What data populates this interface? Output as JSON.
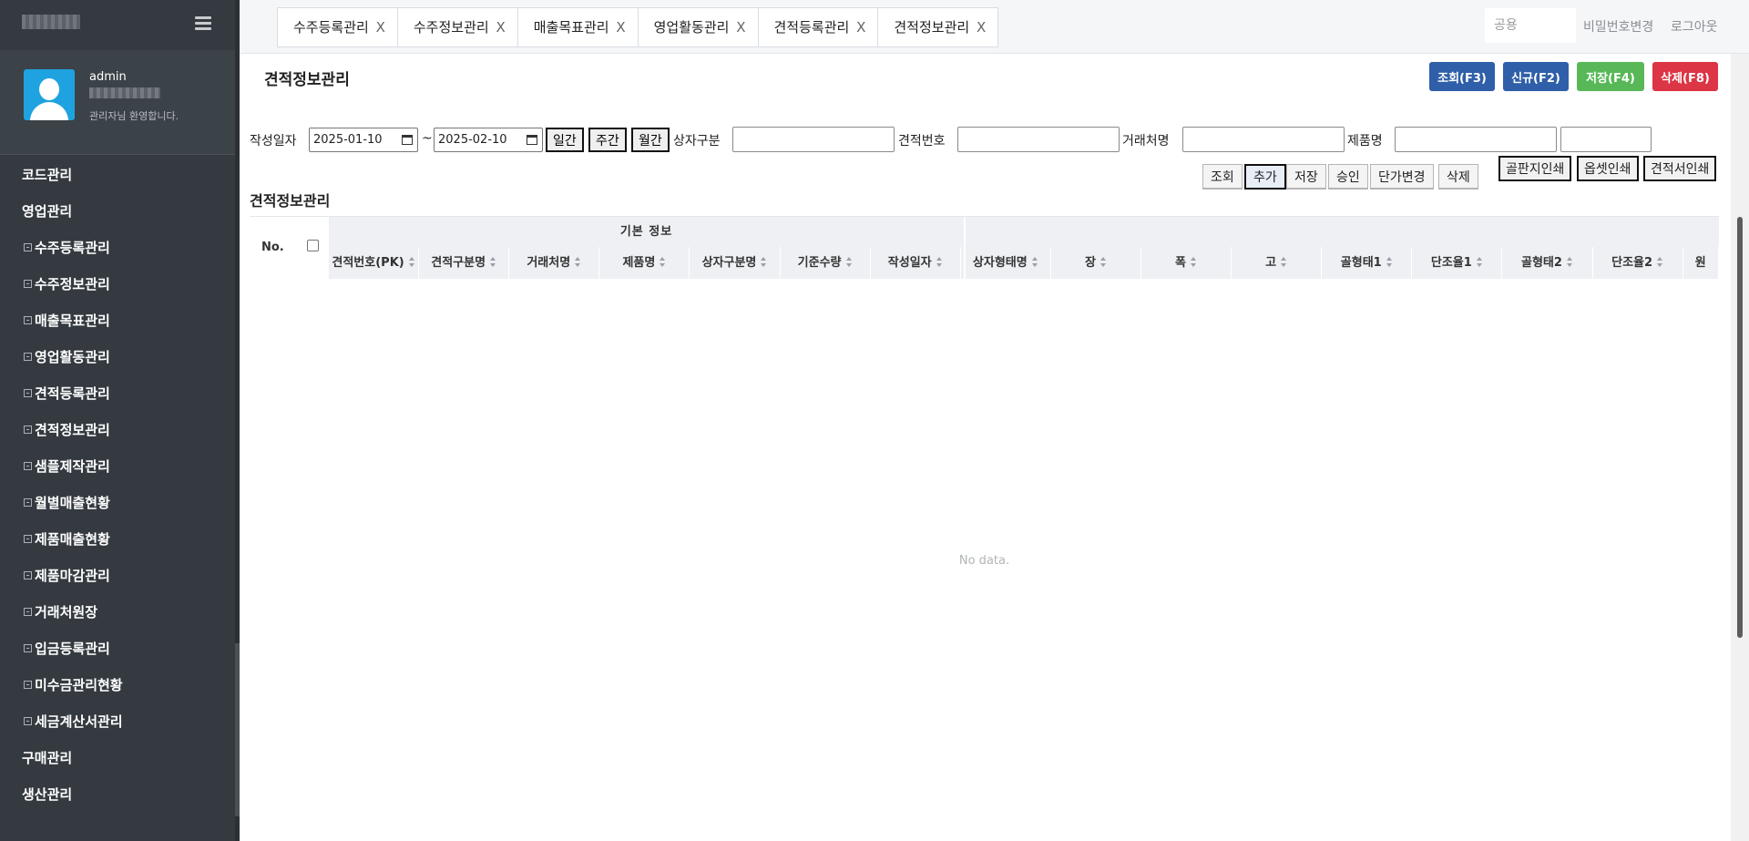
{
  "sidebar": {
    "user": {
      "name": "admin",
      "greeting": "관리자님 환영합니다."
    },
    "menu": [
      {
        "label": "코드관리",
        "sub": false
      },
      {
        "label": "영업관리",
        "sub": false
      },
      {
        "label": "수주등록관리",
        "sub": true
      },
      {
        "label": "수주정보관리",
        "sub": true
      },
      {
        "label": "매출목표관리",
        "sub": true
      },
      {
        "label": "영업활동관리",
        "sub": true
      },
      {
        "label": "견적등록관리",
        "sub": true
      },
      {
        "label": "견적정보관리",
        "sub": true
      },
      {
        "label": "샘플제작관리",
        "sub": true
      },
      {
        "label": "월별매출현황",
        "sub": true
      },
      {
        "label": "제품매출현황",
        "sub": true
      },
      {
        "label": "제품마감관리",
        "sub": true
      },
      {
        "label": "거래처원장",
        "sub": true
      },
      {
        "label": "입금등록관리",
        "sub": true
      },
      {
        "label": "미수금관리현황",
        "sub": true
      },
      {
        "label": "세금계산서관리",
        "sub": true
      },
      {
        "label": "구매관리",
        "sub": false
      },
      {
        "label": "생산관리",
        "sub": false
      }
    ]
  },
  "tabs": [
    "수주등록관리",
    "수주정보관리",
    "매출목표관리",
    "영업활동관리",
    "견적등록관리",
    "견적정보관리"
  ],
  "tab_close": "X",
  "header": {
    "search_placeholder": "공용",
    "change_password": "비밀번호변경",
    "logout": "로그아웃"
  },
  "page": {
    "title": "견적정보관리",
    "actions": {
      "search": "조회(F3)",
      "new": "신규(F2)",
      "save": "저장(F4)",
      "delete": "삭제(F8)"
    }
  },
  "filters": {
    "date_label": "작성일자",
    "date_from": "2025-01-10",
    "date_sep": "~",
    "date_to": "2025-02-10",
    "period_daily": "일간",
    "period_weekly": "주간",
    "period_monthly": "월간",
    "box_type_label": "상자구분",
    "estimate_no_label": "견적번호",
    "client_label": "거래처명",
    "product_label": "제품명"
  },
  "grid_buttons": {
    "search": "조회",
    "add": "추가",
    "save": "저장",
    "approve": "승인",
    "price_change": "단가변경",
    "delete": "삭제"
  },
  "print_buttons": {
    "corrugated": "골판지인쇄",
    "offset": "옵셋인쇄",
    "estimate": "견적서인쇄"
  },
  "grid": {
    "section_title": "견적정보관리",
    "no_label": "No.",
    "group_label": "기본 정보",
    "columns": [
      "견적번호(PK)",
      "견적구분명",
      "거래처명",
      "제품명",
      "상자구분명",
      "기준수량",
      "작성일자",
      "상자형태명",
      "장",
      "폭",
      "고",
      "골형태1",
      "단조율1",
      "골형태2",
      "단조율2",
      "원"
    ],
    "empty_text": "No data."
  }
}
